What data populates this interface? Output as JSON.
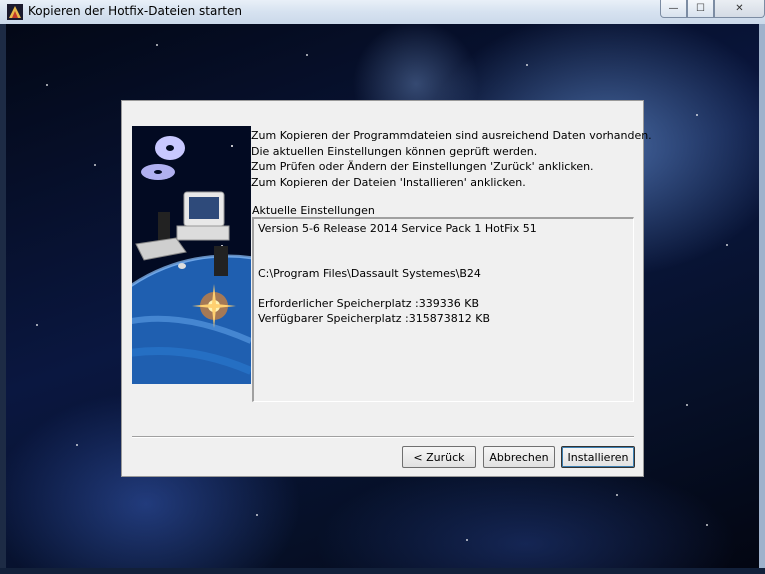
{
  "window": {
    "title": "Kopieren der Hotfix-Dateien starten",
    "caption_buttons": {
      "minimize": "—",
      "maximize": "☐",
      "close": "✕"
    }
  },
  "dialog": {
    "intro_lines": [
      "Zum Kopieren der Programmdateien sind ausreichend Daten vorhanden.",
      "Die aktuellen Einstellungen können geprüft werden.",
      "Zum Prüfen oder Ändern der Einstellungen 'Zurück' anklicken.",
      "Zum Kopieren der Dateien 'Installieren' anklicken."
    ],
    "settings_label": "Aktuelle Einstellungen",
    "settings": {
      "version": "Version 5-6 Release 2014 Service Pack 1 HotFix 51",
      "path": " C:\\Program Files\\Dassault Systemes\\B24",
      "required_space": "Erforderlicher Speicherplatz  :339336 KB",
      "available_space": "Verfügbarer Speicherplatz :315873812 KB"
    },
    "buttons": {
      "back": "< Zurück",
      "cancel": "Abbrechen",
      "install": "Installieren"
    }
  },
  "icons": {
    "app": "setup-app-icon",
    "side_image": "computer-cd-planet-illustration"
  }
}
